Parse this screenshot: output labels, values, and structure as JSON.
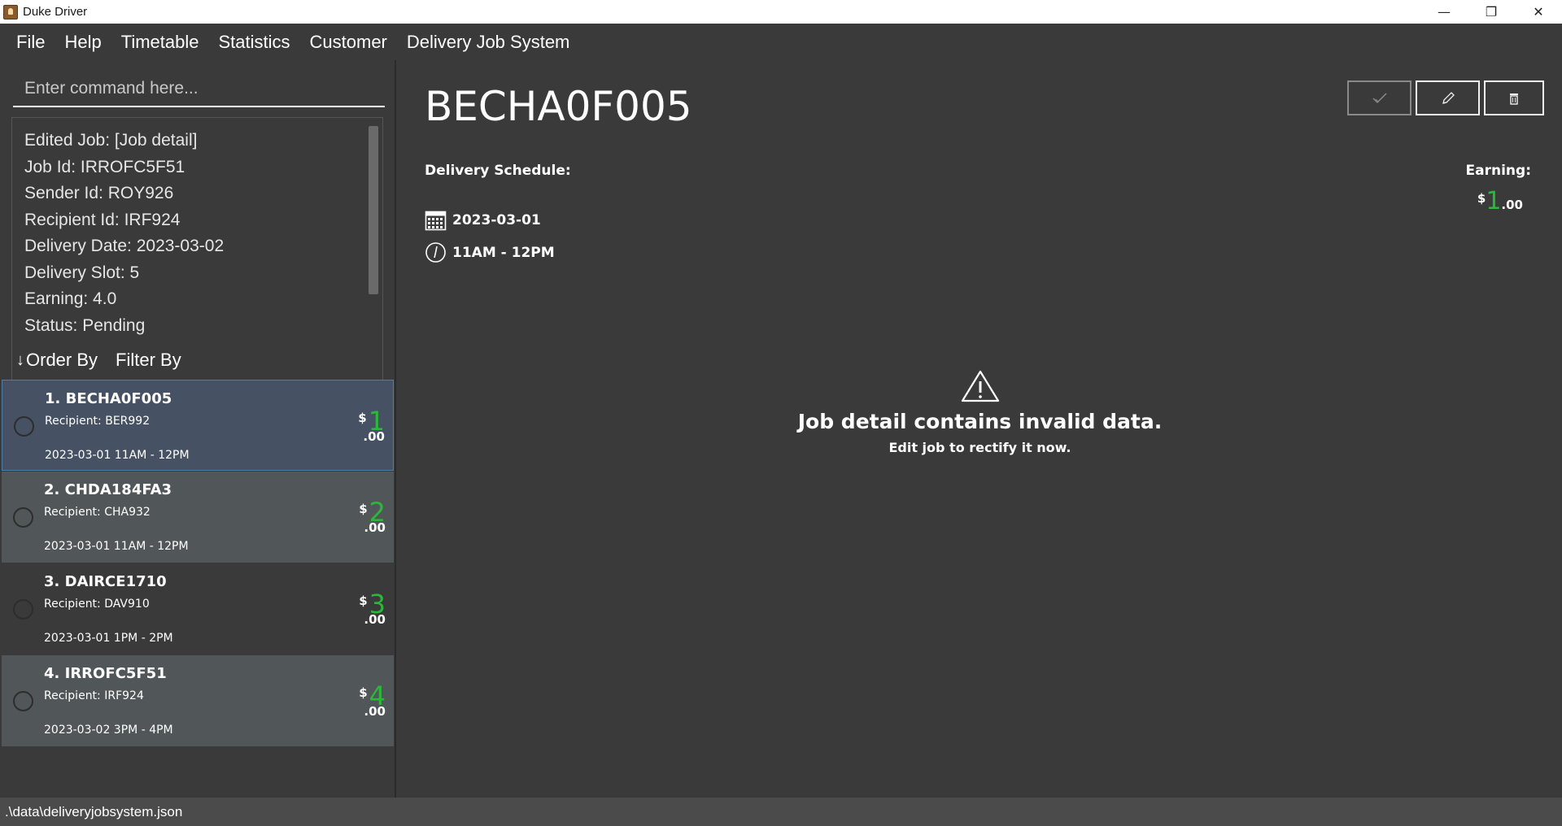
{
  "window": {
    "title": "Duke Driver",
    "minimize_glyph": "—",
    "maximize_glyph": "❐",
    "close_glyph": "✕"
  },
  "menu": {
    "items": [
      "File",
      "Help",
      "Timetable",
      "Statistics",
      "Customer",
      "Delivery Job System"
    ]
  },
  "command": {
    "placeholder": "Enter command here..."
  },
  "result": {
    "lines": [
      "Edited Job: [Job detail]",
      "Job Id: IRROFC5F51",
      "Sender Id: ROY926",
      "Recipient Id: IRF924",
      "Delivery Date: 2023-03-02",
      "Delivery Slot: 5",
      "Earning: 4.0",
      "Status: Pending"
    ]
  },
  "sort": {
    "arrow": "↓",
    "order_by": "Order By",
    "filter_by": "Filter By"
  },
  "jobs": [
    {
      "title": "1.  BECHA0F005",
      "recipient": "Recipient: BER992",
      "datetime": "2023-03-01 11AM - 12PM",
      "dollar": "$",
      "int": "1",
      "cents": ".00"
    },
    {
      "title": "2.  CHDA184FA3",
      "recipient": "Recipient: CHA932",
      "datetime": "2023-03-01 11AM - 12PM",
      "dollar": "$",
      "int": "2",
      "cents": ".00"
    },
    {
      "title": "3.  DAIRCE1710",
      "recipient": "Recipient: DAV910",
      "datetime": "2023-03-01 1PM  - 2PM",
      "dollar": "$",
      "int": "3",
      "cents": ".00"
    },
    {
      "title": "4.  IRROFC5F51",
      "recipient": "Recipient: IRF924",
      "datetime": "2023-03-02 3PM  - 4PM",
      "dollar": "$",
      "int": "4",
      "cents": ".00"
    }
  ],
  "detail": {
    "job_id": "BECHA0F005",
    "schedule_label": "Delivery Schedule:",
    "date": "2023-03-01",
    "time": "11AM - 12PM",
    "earning_label": "Earning:",
    "earning_dollar": "$",
    "earning_int": "1",
    "earning_cents": ".00",
    "warning_title": "Job detail contains invalid data.",
    "warning_sub": "Edit job to rectify it now."
  },
  "status_bar": {
    "path": ".\\data\\deliveryjobsystem.json"
  },
  "colors": {
    "background": "#3a3a3a",
    "accent_green": "#2bb83a",
    "selected_card": "#465263",
    "alt_card": "#515658"
  },
  "icons": {
    "complete": "check-icon",
    "edit": "pencil-icon",
    "delete": "trash-icon",
    "calendar": "calendar-icon",
    "time": "clock-icon",
    "warning": "warning-icon"
  }
}
